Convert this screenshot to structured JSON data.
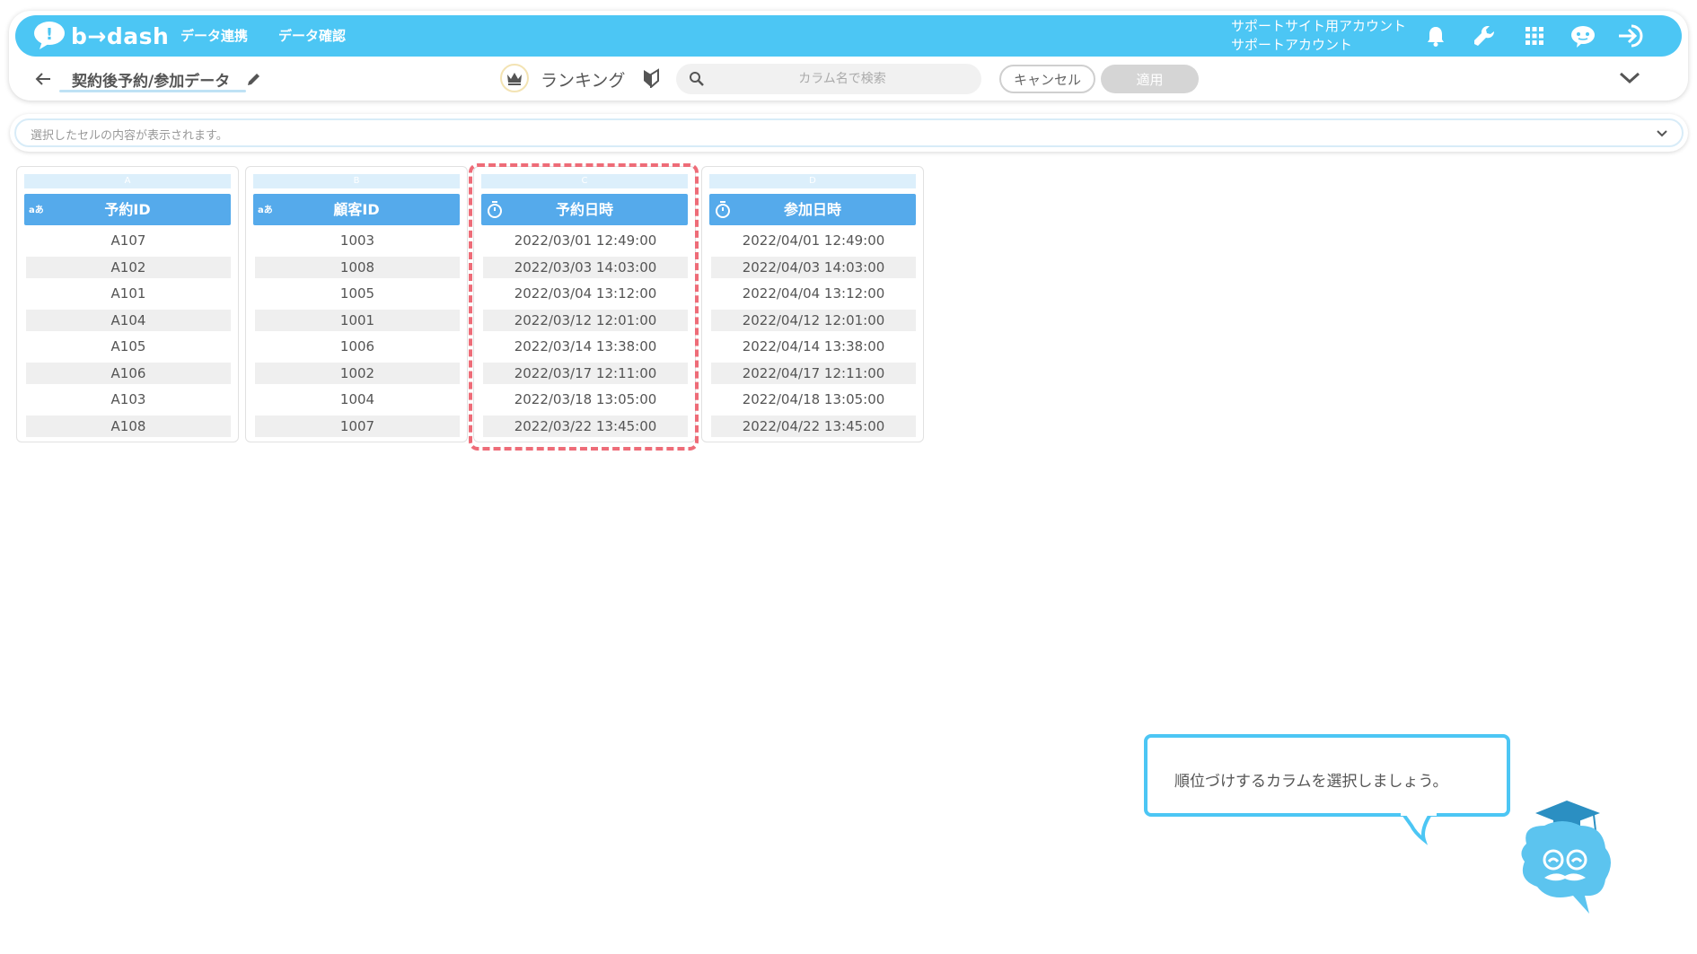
{
  "header": {
    "logo_text": "b→dash",
    "nav": [
      "データ連携",
      "データ確認"
    ],
    "account_line1": "サポートサイト用アカウント",
    "account_line2": "サポートアカウント",
    "icons": [
      "bell-icon",
      "wrench-icon",
      "apps-grid-icon",
      "mascot-help-icon",
      "logout-icon"
    ]
  },
  "toolbar": {
    "page_title": "契約後予約/参加データ",
    "ranking_label": "ランキング",
    "search_placeholder": "カラム名で検索",
    "cancel_label": "キャンセル",
    "apply_label": "適用"
  },
  "cell_bar": {
    "text": "選択したセルの内容が表示されます。"
  },
  "columns": [
    {
      "letter": "A",
      "type": "text",
      "type_label": "aあ",
      "name": "予約ID",
      "values": [
        "A107",
        "A102",
        "A101",
        "A104",
        "A105",
        "A106",
        "A103",
        "A108"
      ]
    },
    {
      "letter": "B",
      "type": "text",
      "type_label": "aあ",
      "name": "顧客ID",
      "values": [
        "1003",
        "1008",
        "1005",
        "1001",
        "1006",
        "1002",
        "1004",
        "1007"
      ]
    },
    {
      "letter": "C",
      "type": "datetime",
      "name": "予約日時",
      "highlighted": true,
      "values": [
        "2022/03/01 12:49:00",
        "2022/03/03 14:03:00",
        "2022/03/04 13:12:00",
        "2022/03/12 12:01:00",
        "2022/03/14 13:38:00",
        "2022/03/17 12:11:00",
        "2022/03/18 13:05:00",
        "2022/03/22 13:45:00"
      ]
    },
    {
      "letter": "D",
      "type": "datetime",
      "name": "参加日時",
      "values": [
        "2022/04/01 12:49:00",
        "2022/04/03 14:03:00",
        "2022/04/04 13:12:00",
        "2022/04/12 12:01:00",
        "2022/04/14 13:38:00",
        "2022/04/17 12:11:00",
        "2022/04/18 13:05:00",
        "2022/04/22 13:45:00"
      ]
    }
  ],
  "tooltip": {
    "text": "順位づけするカラムを選択しましょう。"
  },
  "colors": {
    "brand": "#4cc6f4",
    "column_header": "#55aaeb",
    "highlight": "#ee6c78"
  }
}
